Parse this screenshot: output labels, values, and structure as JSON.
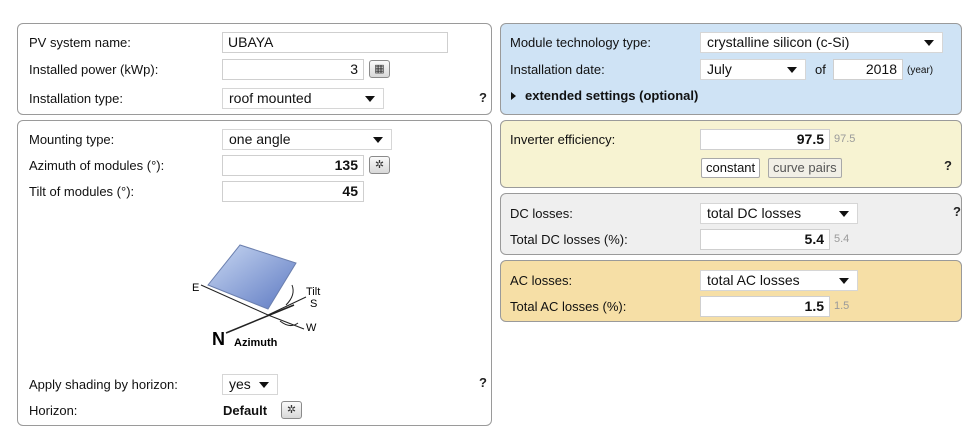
{
  "system": {
    "name_label": "PV system name:",
    "name_value": "UBAYA",
    "power_label": "Installed power (kWp):",
    "power_value": "3",
    "install_type_label": "Installation type:",
    "install_type_value": "roof mounted",
    "help": "?"
  },
  "mounting": {
    "mounting_label": "Mounting type:",
    "mounting_value": "one angle",
    "azimuth_label": "Azimuth of modules (°):",
    "azimuth_value": "135",
    "tilt_label": "Tilt of modules (°):",
    "tilt_value": "45",
    "diagram": {
      "e": "E",
      "tilt": "Tilt",
      "s": "S",
      "w": "W",
      "n": "N",
      "azimuth": "Azimuth"
    },
    "shading_label": "Apply shading by horizon:",
    "shading_value": "yes",
    "horizon_label": "Horizon:",
    "horizon_value": "Default",
    "help": "?"
  },
  "module": {
    "tech_label": "Module technology type:",
    "tech_value": "crystalline silicon (c-Si)",
    "date_label": "Installation date:",
    "month_value": "July",
    "of_text": "of",
    "year_value": "2018",
    "year_unit": "(year)",
    "extended_label": "extended settings (optional)"
  },
  "inverter": {
    "label": "Inverter efficiency:",
    "value": "97.5",
    "hint": "97.5",
    "constant_label": "constant",
    "curve_pairs_label": "curve pairs",
    "help": "?"
  },
  "dc": {
    "type_label": "DC losses:",
    "type_value": "total DC losses",
    "total_label": "Total DC losses (%):",
    "total_value": "5.4",
    "hint": "5.4",
    "help": "?"
  },
  "ac": {
    "type_label": "AC losses:",
    "type_value": "total AC losses",
    "total_label": "Total AC losses (%):",
    "total_value": "1.5",
    "hint": "1.5"
  },
  "colors": {
    "module_panel": "#cfe3f5",
    "inverter_panel": "#f7f3d2",
    "dc_panel": "#efefef",
    "ac_panel": "#f6dfa6"
  }
}
